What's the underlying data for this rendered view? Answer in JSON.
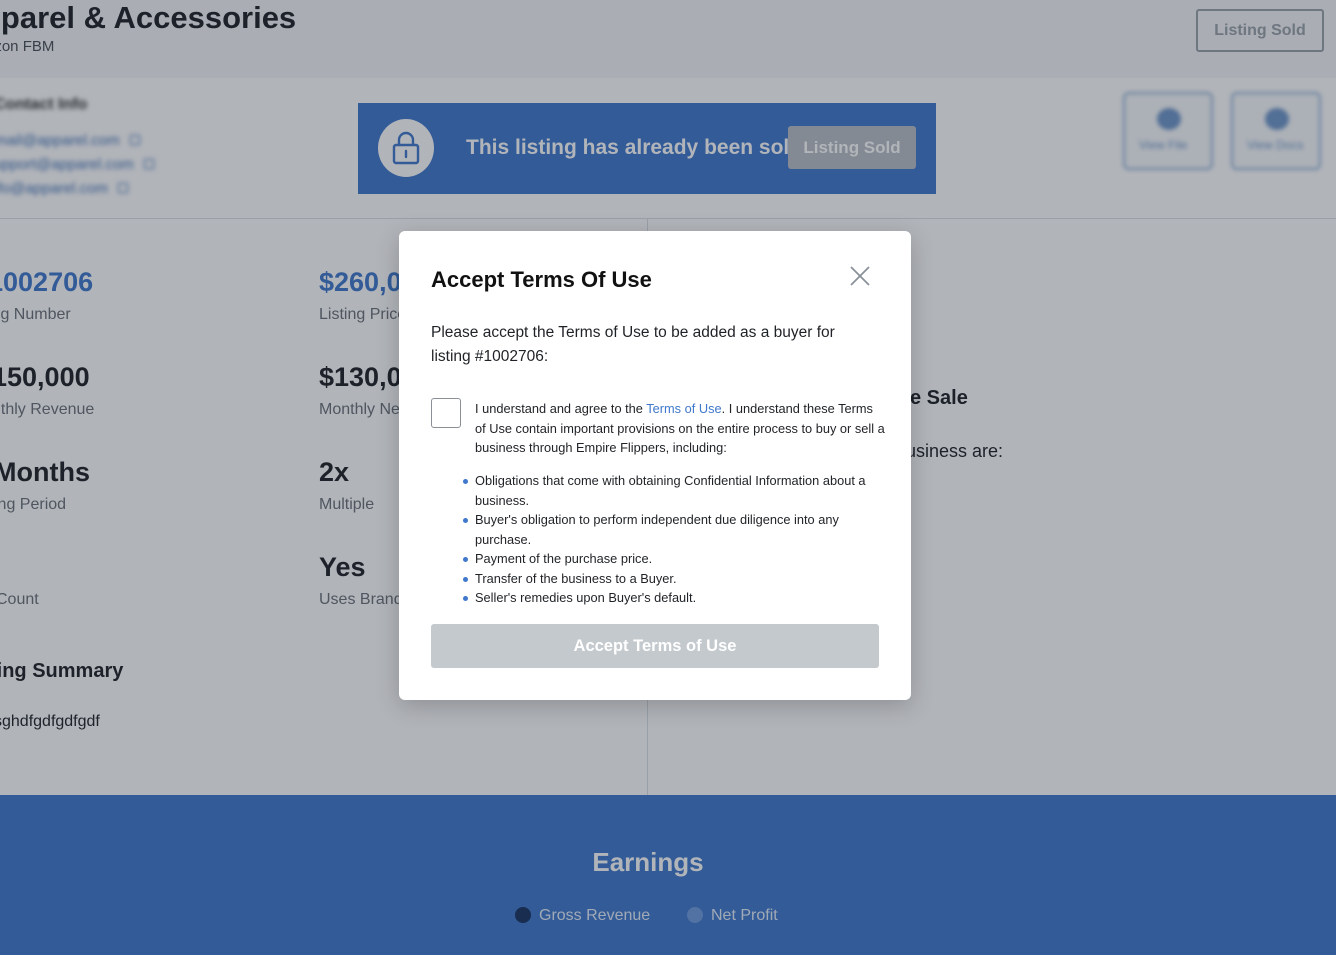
{
  "header": {
    "title": "pparel & Accessories",
    "subtitle": "azon FBM",
    "listing_sold_label": "Listing Sold"
  },
  "contact": {
    "label": "Contact Info",
    "links": [
      "email@apparel.com",
      "support@apparel.com",
      "info@apparel.com"
    ]
  },
  "action_buttons": [
    {
      "label": "View File",
      "icon": "document-icon"
    },
    {
      "label": "View Docs",
      "icon": "file-icon"
    }
  ],
  "sold_banner": {
    "text": "This listing has already been sold",
    "button_label": "Listing Sold",
    "icon": "lock-icon"
  },
  "stats": [
    {
      "value": "1002706",
      "label": "ing Number"
    },
    {
      "value": "$260,0",
      "label": "Listing Price"
    },
    {
      "value": "150,000",
      "label": "nthly Revenue"
    },
    {
      "value": "$130,0",
      "label": "Monthly Ne"
    },
    {
      "value": "Months",
      "label": "ing Period"
    },
    {
      "value": "2x",
      "label": "Multiple"
    },
    {
      "value": "",
      "label": "Count"
    },
    {
      "value": "Yes",
      "label": "Uses Brand"
    }
  ],
  "summary": {
    "title": "ting Summary",
    "text": "sghdfgdfgdfgdf"
  },
  "right_panel": {
    "heading": "e Sale",
    "text": "usiness are:"
  },
  "earnings": {
    "title": "Earnings",
    "legend": [
      {
        "label": "Gross Revenue",
        "color": "#17335e"
      },
      {
        "label": "Net Profit",
        "color": "#6f9be0"
      }
    ]
  },
  "modal": {
    "title": "Accept Terms Of Use",
    "intro": "Please accept the Terms of Use to be added as a buyer for listing #1002706:",
    "agree_prefix": "I understand and agree to the ",
    "terms_link": "Terms of Use",
    "agree_suffix": ". I understand these Terms of Use contain important provisions on the entire process to buy or sell a business through Empire Flippers, including:",
    "bullets": [
      "Obligations that come with obtaining Confidential Information about a business.",
      "Buyer's obligation to perform independent due diligence into any purchase.",
      "Payment of the purchase price.",
      "Transfer of the business to a Buyer.",
      "Seller's remedies upon Buyer's default."
    ],
    "accept_label": "Accept Terms of Use"
  },
  "colors": {
    "brand_blue": "#3f78cc",
    "disabled_gray": "#c4c9ce"
  }
}
